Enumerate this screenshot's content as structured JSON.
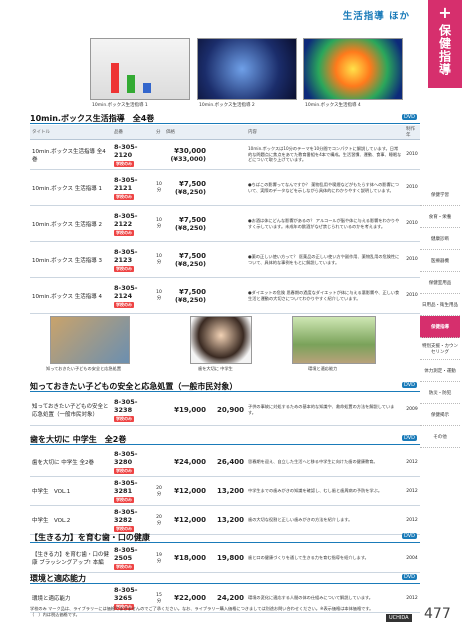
{
  "header": {
    "title": "生活指導 ほか"
  },
  "side_tab": {
    "plus": "+",
    "label": "保健指導"
  },
  "top_captions": [
    "10min.ボックス生活指導 1",
    "10min.ボックス生活指導 2",
    "10min.ボックス生活指導 4"
  ],
  "section1": {
    "heading": "10min.ボックス生活指導　全4巻",
    "badge": "DVD",
    "columns": [
      "タイトル",
      "品番",
      "分",
      "価格",
      "",
      "内容",
      "制作年"
    ],
    "rows": [
      {
        "name": "10min.ボックス生活指導 全4巻",
        "code": "8-305-2120",
        "tag": "学校のみ",
        "mins": "",
        "price": "¥30,000",
        "price_sub": "(¥33,000)",
        "desc": "10min.ボックスは10分のテーマを10分間でコンパクトに解説しています。日常的な問題点に焦点をあてた教育番組を4本で構成。生活習慣、運動、食事、睡眠などについて取り上げています。",
        "year": "2010"
      },
      {
        "name": "10min.ボックス 生活指導 1",
        "code": "8-305-2121",
        "tag": "学校のみ",
        "mins": "10分",
        "price": "¥7,500",
        "price_sub": "(¥8,250)",
        "desc": "●ちばこの影響ってなんですか？ 薬物乱用や喫煙などがもたらす体への影響について、実際のデータなどを示しながら具体的にわかりやすく説明しています。",
        "year": "2010"
      },
      {
        "name": "10min.ボックス 生活指導 2",
        "code": "8-305-2122",
        "tag": "学校のみ",
        "mins": "10分",
        "price": "¥7,500",
        "price_sub": "(¥8,250)",
        "desc": "●お酒は体にどんな影響があるの？ アルコールが脳や体に与える影響をわかりやすく示しています。未成年の飲酒がなぜ禁じられているのかを考えます。",
        "year": "2010"
      },
      {
        "name": "10min.ボックス 生活指導 3",
        "code": "8-305-2123",
        "tag": "学校のみ",
        "mins": "10分",
        "price": "¥7,500",
        "price_sub": "(¥8,250)",
        "desc": "●薬の正しい使い方って？ 医薬品の正しい使い方や副作用、薬物乱用の危険性について、具体的な事例をもとに解説しています。",
        "year": "2010"
      },
      {
        "name": "10min.ボックス 生活指導 4",
        "code": "8-305-2124",
        "tag": "学校のみ",
        "mins": "10分",
        "price": "¥7,500",
        "price_sub": "(¥8,250)",
        "desc": "●ダイエットの危険 思春期の過度なダイエットが体に与える悪影響や、正しい食生活と運動の大切さについてわかりやすく紹介しています。",
        "year": "2010"
      }
    ]
  },
  "mid_captions": [
    "知っておきたい子どもの安全と応急処置",
    "歯を大切に 中学生",
    "環境と適応能力"
  ],
  "section2": {
    "heading": "知っておきたい子どもの安全と応急処置（一般市民対象）",
    "badge": "DVD",
    "rows": [
      {
        "name": "知っておきたい子どもの安全と応急処置（一般市民対象）",
        "code": "8-305-3238",
        "tag": "学校のみ",
        "mins": "",
        "price": "¥19,000",
        "price2": "20,900",
        "desc": "子供の事故に対処するための基本的な知識や、救命処置の方法を解説しています。",
        "year": "2009"
      }
    ]
  },
  "section3": {
    "heading": "歯を大切に 中学生　全2巻",
    "badge": "DVD",
    "rows": [
      {
        "name": "歯を大切に 中学生 全2巻",
        "code": "8-305-3280",
        "tag": "学校のみ",
        "mins": "",
        "price": "¥24,000",
        "price2": "26,400",
        "desc": "思春期を迎え、自立した生活へと移る中学生に向けた歯の健康教育。",
        "year": "2012"
      },
      {
        "name": "中学生　VOL.1",
        "code": "8-305-3281",
        "tag": "学校のみ",
        "mins": "20分",
        "price": "¥12,000",
        "price2": "13,200",
        "desc": "中学生までの歯みがきの知識を確認し、むし歯と歯周病の予防を学ぶ。",
        "year": "2012"
      },
      {
        "name": "中学生　VOL.2",
        "code": "8-305-3282",
        "tag": "学校のみ",
        "mins": "20分",
        "price": "¥12,000",
        "price2": "13,200",
        "desc": "歯の大切な役割と正しい歯みがきの方法を紹介します。",
        "year": "2012"
      }
    ]
  },
  "section4": {
    "heading": "【生きる力】を育む歯・口の健康",
    "badge": "DVD",
    "rows": [
      {
        "name": "【生きる力】を育む歯・口の健康 ブラッシングアップ! 本編",
        "code": "8-305-2505",
        "tag": "学校のみ",
        "mins": "19分",
        "price": "¥18,000",
        "price2": "19,800",
        "desc": "歯と口の健康づくりを通して生きる力を育む指導を紹介します。",
        "year": "2004"
      }
    ]
  },
  "section5": {
    "heading": "環境と適応能力",
    "badge": "DVD",
    "rows": [
      {
        "name": "環境と適応能力",
        "code": "8-305-3265",
        "tag": "学校のみ",
        "mins": "15分",
        "price": "¥22,000",
        "price2": "24,200",
        "desc": "環境の変化に適応する人間の体の仕組みについて解説しています。",
        "year": "2012"
      }
    ]
  },
  "side_nav": [
    {
      "label": "保健学習",
      "active": false
    },
    {
      "label": "食育・栄養",
      "active": false
    },
    {
      "label": "健康診断",
      "active": false
    },
    {
      "label": "医療器機",
      "active": false
    },
    {
      "label": "保健室用品",
      "active": false
    },
    {
      "label": "日用品・衛生用品",
      "active": false
    },
    {
      "label": "保健指導",
      "active": true
    },
    {
      "label": "特別支援・カウンセリング",
      "active": false
    },
    {
      "label": "体力測定・運動",
      "active": false
    },
    {
      "label": "防災・防犯",
      "active": false
    },
    {
      "label": "保健掲示",
      "active": false
    },
    {
      "label": "その他",
      "active": false
    }
  ],
  "footer": {
    "note": "学校のみ マーク品は、ライブラリーには価格でまきませんのでご了承ください。なお、ライブラリー購入価格につきましては別途お問い合わせください。※表示価格は本体価格です。（　）内は税込価格です。",
    "logo": "UCHIDA",
    "page": "477"
  }
}
